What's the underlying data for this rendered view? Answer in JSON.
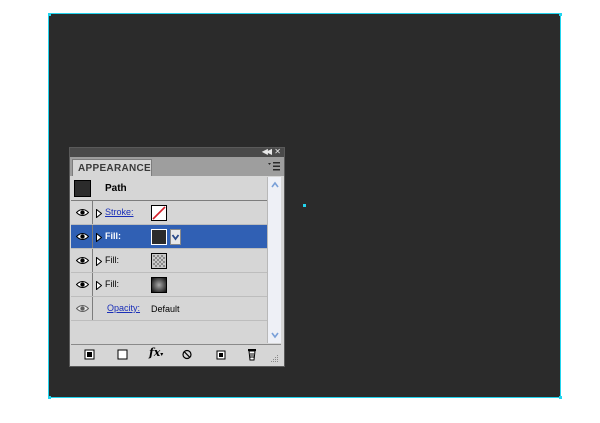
{
  "panel": {
    "tab_label": "APPEARANCE",
    "header": {
      "title": "Path"
    },
    "rows": [
      {
        "label": "Stroke:",
        "swatch": "none"
      },
      {
        "label": "Fill:",
        "swatch": "#2b2b2b",
        "selected": true
      },
      {
        "label": "Fill:",
        "swatch": "pattern"
      },
      {
        "label": "Fill:",
        "swatch": "radial-gradient"
      }
    ],
    "opacity": {
      "label": "Opacity:",
      "value": "Default"
    }
  },
  "toolbar": {
    "fx_label": "fx"
  },
  "colors": {
    "artboard": "#2b2b2b",
    "selection": "#22d4ee",
    "selected_row": "#3060b4",
    "panel_bg": "#d6d6d6"
  },
  "icons": [
    "collapse-icon",
    "close-icon",
    "panel-menu-icon",
    "eye-icon",
    "disclosure-triangle-icon",
    "chevron-down-icon",
    "scroll-up-icon",
    "scroll-down-icon",
    "add-new-stroke-icon",
    "add-new-fill-icon",
    "clear-appearance-icon",
    "duplicate-item-icon",
    "delete-item-icon",
    "resize-grip-icon"
  ]
}
